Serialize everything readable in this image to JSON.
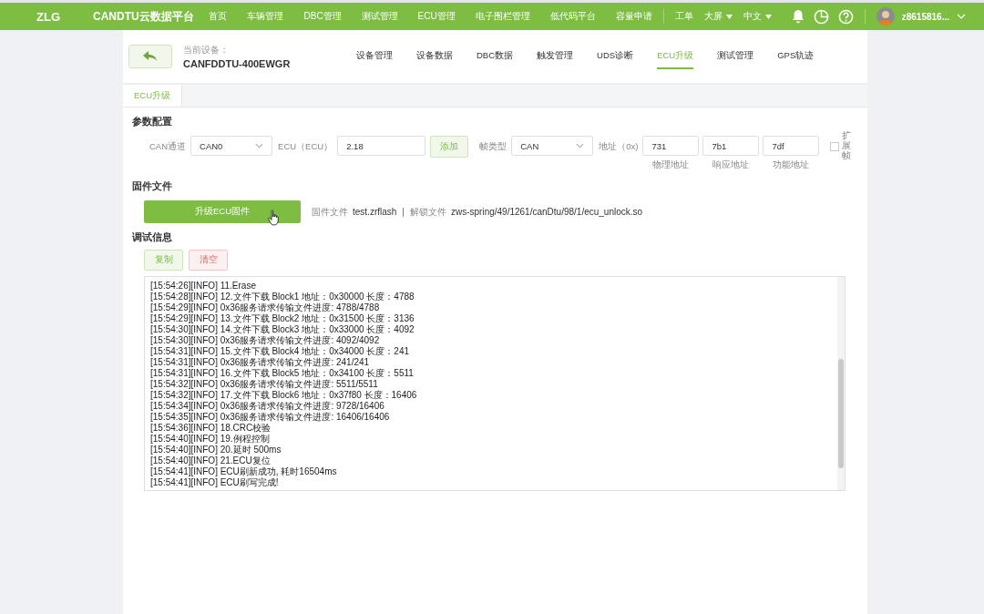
{
  "topbar": {
    "logo": "ZLG",
    "title": "CANDTU云数据平台",
    "nav": [
      {
        "label": "首页",
        "selected": false
      },
      {
        "label": "车辆管理",
        "selected": false
      },
      {
        "label": "DBC管理",
        "selected": false
      },
      {
        "label": "测试管理",
        "selected": false
      },
      {
        "label": "ECU管理",
        "selected": false
      },
      {
        "label": "电子围栏管理",
        "selected": false
      },
      {
        "label": "低代码平台",
        "selected": false
      },
      {
        "label": "容量申请",
        "selected": false
      }
    ],
    "tools": [
      {
        "label": "工单",
        "dropdown": false
      },
      {
        "label": "大屏",
        "dropdown": true
      },
      {
        "label": "中文",
        "dropdown": true
      }
    ],
    "user": "z8615816..."
  },
  "device": {
    "label": "当前设备：",
    "name": "CANFDDTU-400EWGR",
    "tabs": [
      {
        "label": "设备管理",
        "selected": false
      },
      {
        "label": "设备数据",
        "selected": false
      },
      {
        "label": "DBC数据",
        "selected": false
      },
      {
        "label": "触发管理",
        "selected": false
      },
      {
        "label": "UDS诊断",
        "selected": false
      },
      {
        "label": "ECU升级",
        "selected": true
      },
      {
        "label": "测试管理",
        "selected": false
      },
      {
        "label": "GPS轨迹",
        "selected": false
      }
    ]
  },
  "subtabs": [
    {
      "label": "ECU升级",
      "selected": true
    }
  ],
  "params": {
    "heading": "参数配置",
    "channel_label": "CAN通道",
    "channel": "CAN0",
    "ecu_label": "ECU（ECU）",
    "ecu": "2.18",
    "add": "添加",
    "frame_label": "帧类型",
    "frame": "CAN",
    "addr_label": "地址（0x)",
    "addresses": [
      {
        "value": "731",
        "caption": "物理地址"
      },
      {
        "value": "7b1",
        "caption": "响应地址"
      },
      {
        "value": "7df",
        "caption": "功能地址"
      }
    ],
    "extended": {
      "label": "扩展帧",
      "checked": false
    }
  },
  "firmware": {
    "heading": "固件文件",
    "button": "升级ECU固件",
    "file_label": "固件文件",
    "file": "test.zrflash",
    "sep": "|",
    "unlock_label": "解锁文件",
    "unlock": "zws-spring/49/1261/canDtu/98/1/ecu_unlock.so"
  },
  "debug": {
    "heading": "调试信息",
    "copy": "复制",
    "clear": "清空",
    "log": [
      "[15:54:26][INFO] 11.Erase",
      "[15:54:28][INFO] 12.文件下载 Block1 地址：0x30000 长度：4788",
      "[15:54:29][INFO] 0x36服务请求传输文件进度: 4788/4788",
      "[15:54:29][INFO] 13.文件下载 Block2 地址：0x31500 长度：3136",
      "[15:54:30][INFO] 14.文件下载 Block3 地址：0x33000 长度：4092",
      "[15:54:30][INFO] 0x36服务请求传输文件进度: 4092/4092",
      "[15:54:31][INFO] 15.文件下载 Block4 地址：0x34000 长度：241",
      "[15:54:31][INFO] 0x36服务请求传输文件进度: 241/241",
      "[15:54:31][INFO] 16.文件下载 Block5 地址：0x34100 长度：5511",
      "[15:54:32][INFO] 0x36服务请求传输文件进度: 5511/5511",
      "[15:54:32][INFO] 17.文件下载 Block6 地址：0x37f80 长度：16406",
      "[15:54:34][INFO] 0x36服务请求传输文件进度: 9728/16406",
      "[15:54:35][INFO] 0x36服务请求传输文件进度: 16406/16406",
      "[15:54:36][INFO] 18.CRC校验",
      "[15:54:40][INFO] 19.例程控制",
      "[15:54:40][INFO] 20.延时 500ms",
      "[15:54:40][INFO] 21.ECU复位",
      "[15:54:41][INFO] ECU刷新成功, 耗时16504ms",
      "[15:54:41][INFO] ECU刷写完成!"
    ]
  }
}
